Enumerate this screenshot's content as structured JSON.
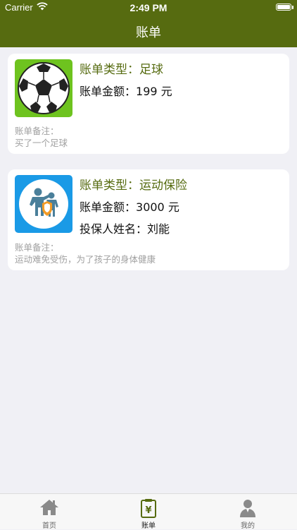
{
  "status": {
    "carrier": "Carrier",
    "time": "2:49 PM"
  },
  "nav": {
    "title": "账单"
  },
  "bills": [
    {
      "type_label": "账单类型：",
      "type_value": "足球",
      "amount_label": "账单金额：",
      "amount_value": "199 元",
      "note_label": "账单备注：",
      "note": "买了一个足球",
      "icon": "soccer-ball"
    },
    {
      "type_label": "账单类型：",
      "type_value": "运动保险",
      "amount_label": "账单金额：",
      "amount_value": "3000 元",
      "insured_label": "投保人姓名：",
      "insured_value": "刘能",
      "note_label": "账单备注：",
      "note": "运动难免受伤，为了孩子的身体健康",
      "icon": "family-insurance"
    }
  ],
  "tabs": [
    {
      "label": "首页",
      "icon": "home-icon"
    },
    {
      "label": "账单",
      "icon": "bill-icon",
      "active": true
    },
    {
      "label": "我的",
      "icon": "user-icon"
    }
  ],
  "colors": {
    "nav": "#566b10",
    "accent": "#566b10",
    "background": "#f0f0f5"
  }
}
